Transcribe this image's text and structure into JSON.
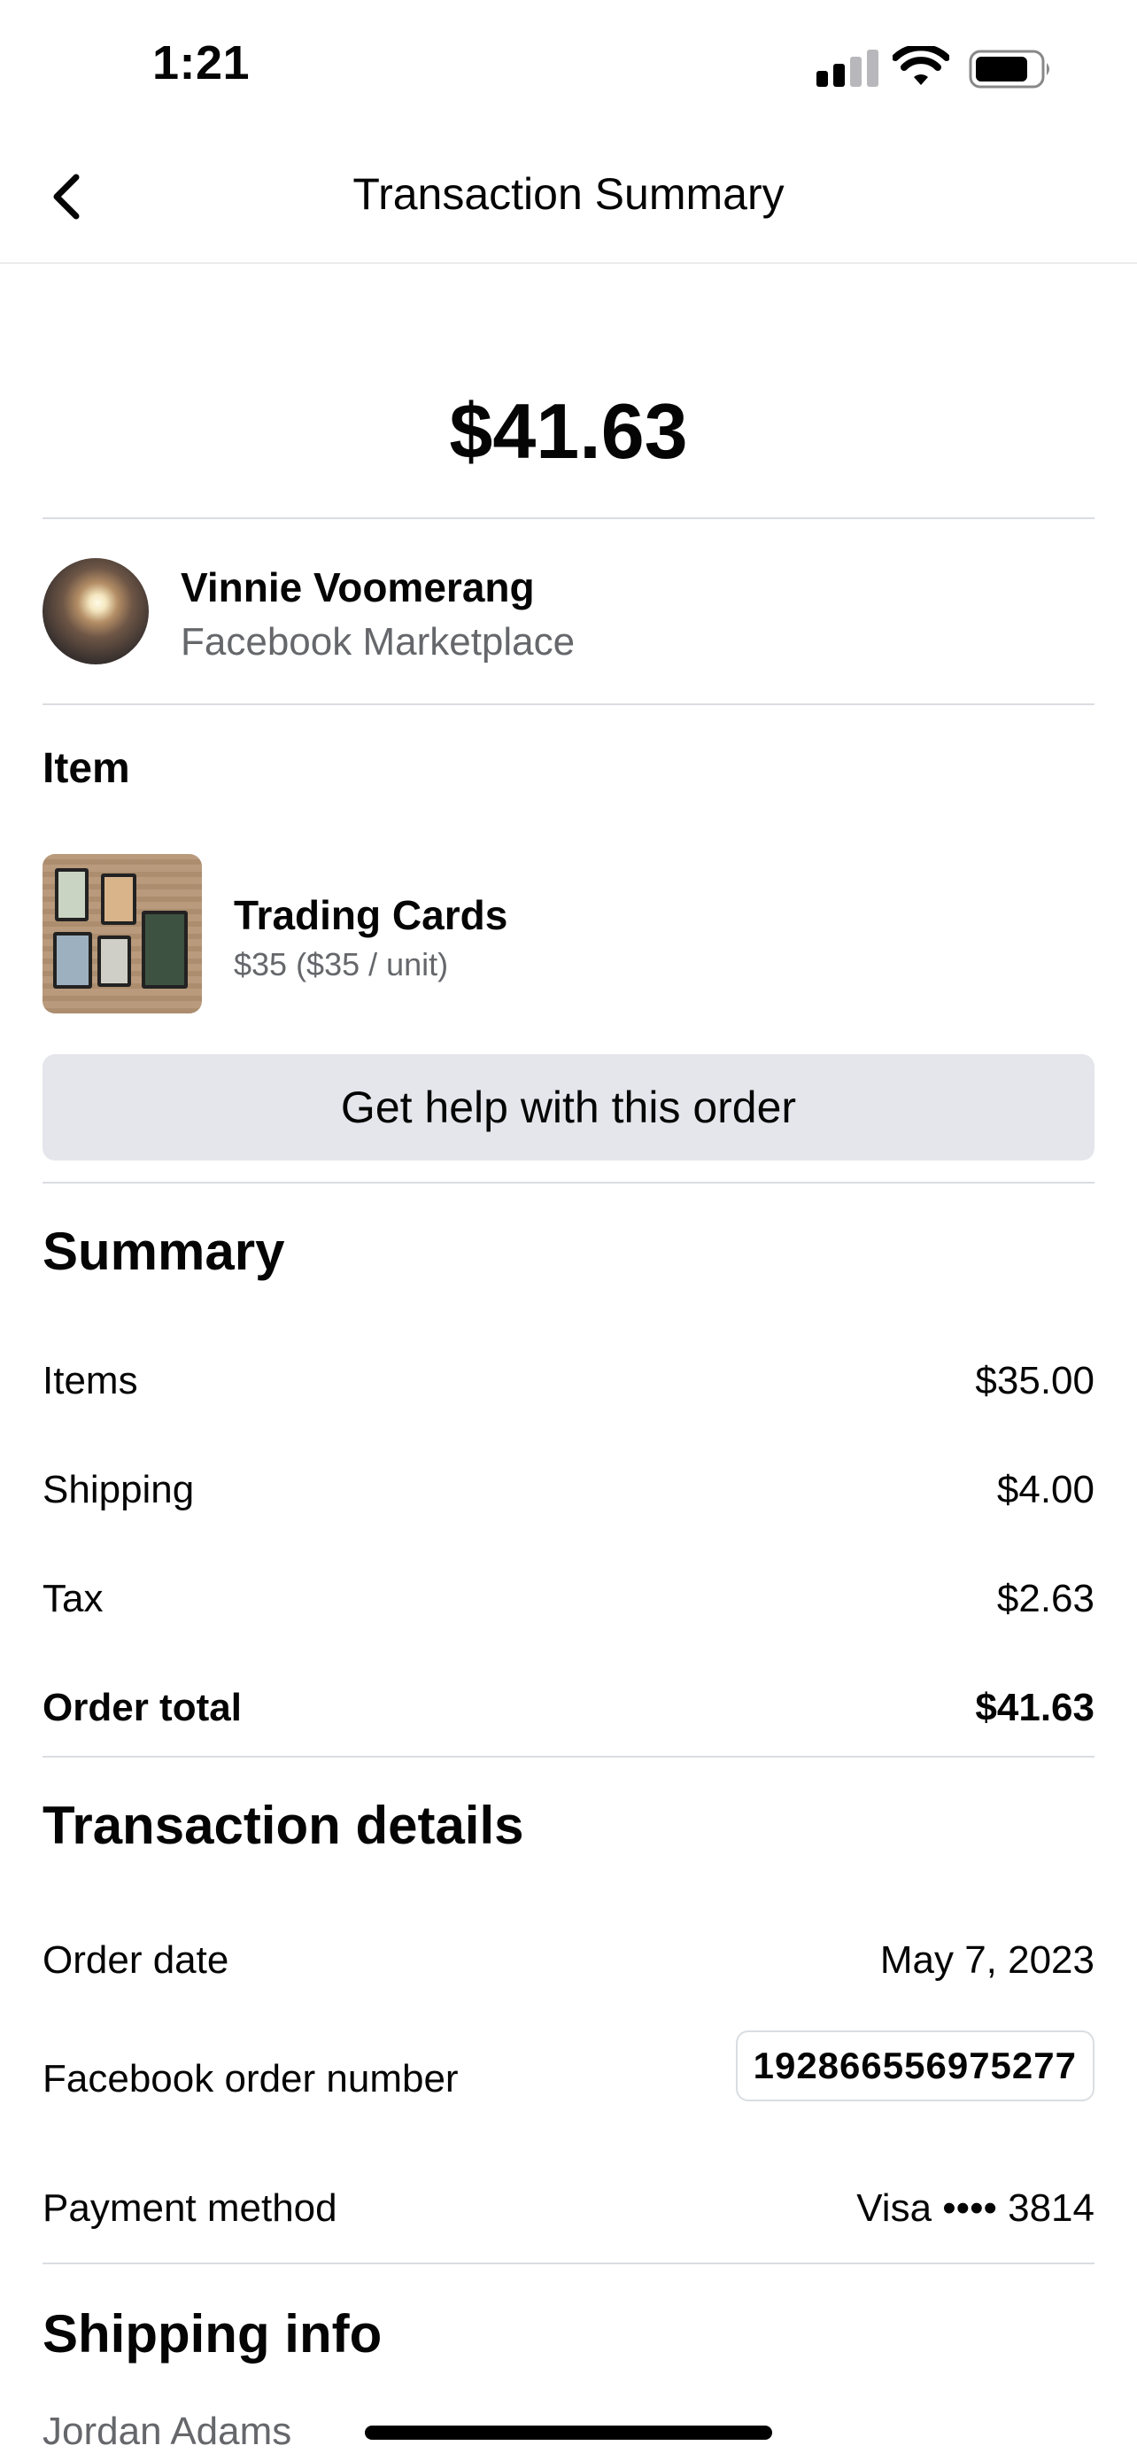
{
  "status_bar": {
    "time": "1:21",
    "signal_icon": "cellular-signal-icon",
    "wifi_icon": "wifi-icon",
    "battery_icon": "battery-icon"
  },
  "header": {
    "back_icon": "chevron-left-icon",
    "title": "Transaction Summary"
  },
  "total_amount": "$41.63",
  "seller": {
    "name": "Vinnie Voomerang",
    "source": "Facebook Marketplace"
  },
  "item_section": {
    "title": "Item",
    "name": "Trading Cards",
    "price": "$35 ($35 / unit)"
  },
  "help_button": {
    "label": "Get help with this order"
  },
  "summary": {
    "title": "Summary",
    "rows": [
      {
        "label": "Items",
        "value": "$35.00"
      },
      {
        "label": "Shipping",
        "value": "$4.00"
      },
      {
        "label": "Tax",
        "value": "$2.63"
      }
    ],
    "total": {
      "label": "Order total",
      "value": "$41.63"
    }
  },
  "transaction": {
    "title": "Transaction details",
    "order_date": {
      "label": "Order date",
      "value": "May 7, 2023"
    },
    "order_number": {
      "label": "Facebook order number",
      "value": "192866556975277"
    },
    "payment": {
      "label": "Payment method",
      "value": "Visa •••• 3814"
    }
  },
  "shipping": {
    "title": "Shipping info",
    "name": "Jordan Adams"
  },
  "colors": {
    "text": "#050505",
    "secondary_text": "#65676b",
    "button_bg": "#e4e6eb",
    "divider": "#dadde1"
  }
}
